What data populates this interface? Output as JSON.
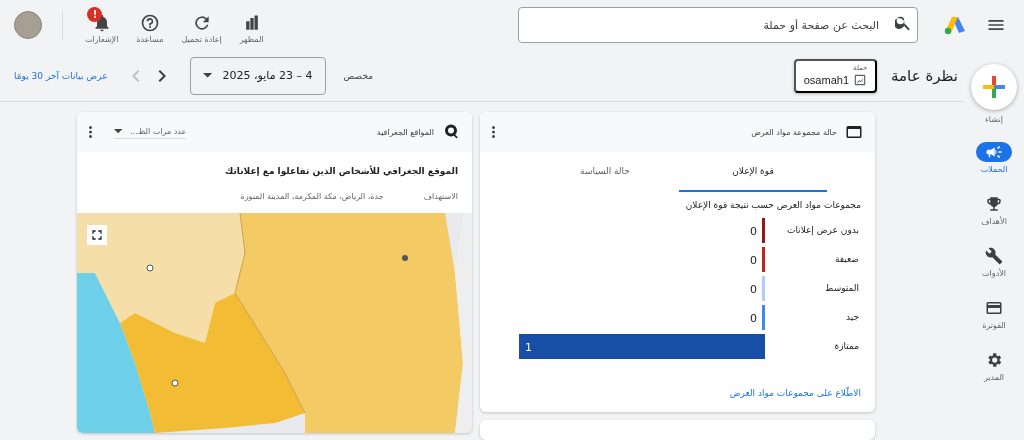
{
  "top_bar": {
    "search": {
      "placeholder": "البحث عن صفحة أو حملة"
    },
    "actions": [
      {
        "kind": "appearance",
        "label": "المظهر"
      },
      {
        "kind": "reload",
        "label": "إعادة تحميل"
      },
      {
        "kind": "help",
        "label": "مساعدة"
      },
      {
        "kind": "notifications",
        "label": "الإشعارات",
        "badge": "!"
      }
    ]
  },
  "nav": {
    "create_label": "إنشاء",
    "items": [
      {
        "kind": "campaigns",
        "label": "الحملات",
        "selected": true
      },
      {
        "kind": "goals",
        "label": "الأهداف",
        "selected": false
      },
      {
        "kind": "tools",
        "label": "الأدوات",
        "selected": false
      },
      {
        "kind": "billing",
        "label": "الفوترة",
        "selected": false
      },
      {
        "kind": "admin",
        "label": "المدير",
        "selected": false
      }
    ]
  },
  "header": {
    "title": "نظرة عامة",
    "campaign": {
      "label": "حملة",
      "value": "osamah1"
    },
    "date_range": {
      "label": "مخصص",
      "value": "4 – 23 مايو، 2025"
    },
    "link": "عرض بيانات آخر 30 يومًا"
  },
  "asset_card": {
    "title": "حالة مجموعة مواد العرض",
    "tabs": [
      {
        "label": "قوة الإعلان",
        "selected": true
      },
      {
        "label": "حالة السياسة",
        "selected": false
      }
    ],
    "subtitle": "مجموعات مواد العرض حسب نتيجة قوة الإعلان",
    "chart_data": {
      "type": "bar",
      "orientation": "horizontal",
      "data_labels": true,
      "categories": [
        "بدون عرض إعلانات",
        "ضعيفة",
        "المتوسط",
        "جيد",
        "ممتازة"
      ],
      "values": [
        0,
        0,
        0,
        0,
        1
      ],
      "colors": [
        "#8e1b1b",
        "#c5221f",
        "#aecbfa",
        "#4285f4",
        "#174ea6"
      ]
    },
    "link": "الاطّلاع على مجموعات مواد العرض"
  },
  "geo_card": {
    "title": "المواقع الجغرافية",
    "metric_dropdown": "عدد مرات الظ...",
    "heading": "الموقع الجغرافي للأشخاص الذين تفاعلوا مع إعلاناتك",
    "targeting_label": "الاستهداف",
    "targeting_value": "جدة، الرياض، مكة المكرمة، المدينة المنورة"
  }
}
